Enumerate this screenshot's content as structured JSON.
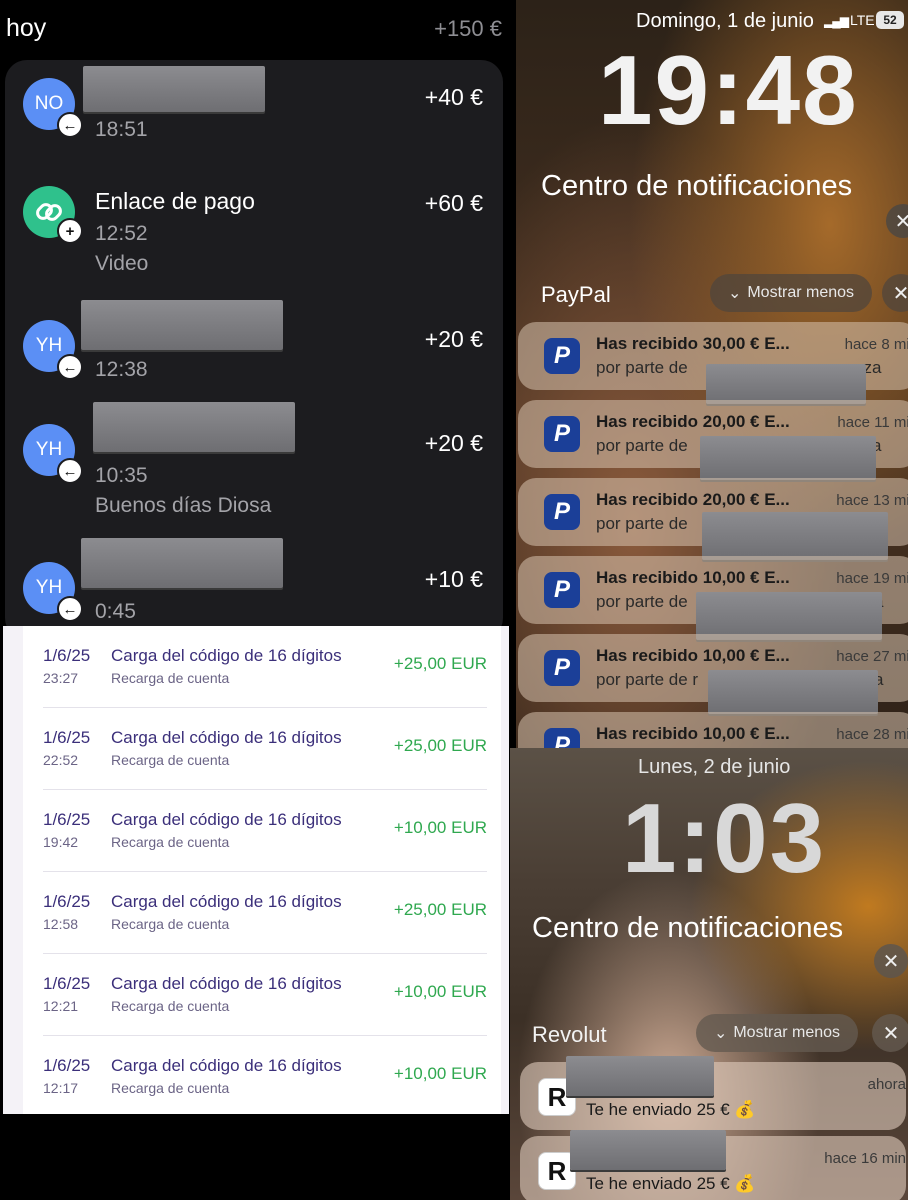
{
  "transactions": {
    "day_label": "hoy",
    "day_total": "+150 €",
    "items": [
      {
        "avatar": "NO",
        "title": "",
        "time": "18:51",
        "note": "",
        "amount": "+40 €"
      },
      {
        "avatar": "",
        "icon": "link-icon",
        "title": "Enlace de pago",
        "time": "12:52",
        "note": "Video",
        "amount": "+60 €"
      },
      {
        "avatar": "YH",
        "title": "",
        "time": "12:38",
        "note": "",
        "amount": "+20 €"
      },
      {
        "avatar": "YH",
        "title": "",
        "time": "10:35",
        "note": "Buenos días Diosa",
        "amount": "+20 €"
      },
      {
        "avatar": "YH",
        "title": "",
        "time": "0:45",
        "note": "",
        "amount": "+10 €"
      }
    ]
  },
  "recharges": [
    {
      "date": "1/6/25",
      "time": "23:27",
      "title": "Carga del código de 16 dígitos",
      "subtitle": "Recarga de cuenta",
      "amount": "+25,00 EUR"
    },
    {
      "date": "1/6/25",
      "time": "22:52",
      "title": "Carga del código de 16 dígitos",
      "subtitle": "Recarga de cuenta",
      "amount": "+25,00 EUR"
    },
    {
      "date": "1/6/25",
      "time": "19:42",
      "title": "Carga del código de 16 dígitos",
      "subtitle": "Recarga de cuenta",
      "amount": "+10,00 EUR"
    },
    {
      "date": "1/6/25",
      "time": "12:58",
      "title": "Carga del código de 16 dígitos",
      "subtitle": "Recarga de cuenta",
      "amount": "+25,00 EUR"
    },
    {
      "date": "1/6/25",
      "time": "12:21",
      "title": "Carga del código de 16 dígitos",
      "subtitle": "Recarga de cuenta",
      "amount": "+10,00 EUR"
    },
    {
      "date": "1/6/25",
      "time": "12:17",
      "title": "Carga del código de 16 dígitos",
      "subtitle": "Recarga de cuenta",
      "amount": "+10,00 EUR"
    }
  ],
  "lock_paypal": {
    "status_date": "Domingo, 1 de junio",
    "network": "LTE",
    "battery": "52",
    "clock": "19:48",
    "nc_title": "Centro de notificaciones",
    "app": "PayPal",
    "show_less": "Mostrar menos",
    "notifications": [
      {
        "title": "Has recibido 30,00 € E...",
        "sub": "por parte de",
        "tail": "oza",
        "time": "hace 8 min"
      },
      {
        "title": "Has recibido 20,00 € E...",
        "sub": "por parte de",
        "tail": "a",
        "time": "hace 11 min"
      },
      {
        "title": "Has recibido 20,00 € E...",
        "sub": "por parte de",
        "tail": "",
        "time": "hace 13 min"
      },
      {
        "title": "Has recibido 10,00 € E...",
        "sub": "por parte de",
        "tail": "a",
        "time": "hace 19 min"
      },
      {
        "title": "Has recibido 10,00 € E...",
        "sub": "por parte de r",
        "tail": "a",
        "time": "hace 27 min"
      },
      {
        "title": "Has recibido 10,00 € E...",
        "sub": "",
        "tail": "",
        "time": "hace 28 min"
      }
    ]
  },
  "lock_revolut": {
    "status_date": "Lunes, 2 de junio",
    "clock": "1:03",
    "nc_title": "Centro de notificaciones",
    "app": "Revolut",
    "show_less": "Mostrar menos",
    "notifications": [
      {
        "message": "Te he enviado 25 € 💰",
        "time": "ahora"
      },
      {
        "message": "Te he enviado 25 € 💰",
        "time": "hace 16 min"
      }
    ]
  },
  "colors": {
    "positive_amount": "#2fa84f",
    "paypal_blue": "#1b3f98",
    "avatar_blue": "#5b8ff5",
    "avatar_green": "#2fc18c"
  }
}
